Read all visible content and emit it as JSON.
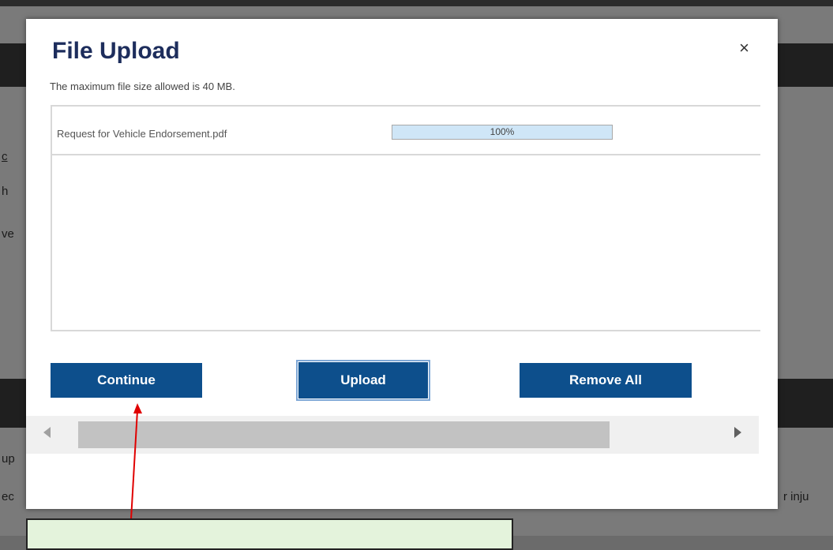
{
  "background": {
    "fragments": [
      "c",
      "h",
      "ve",
      "up",
      "ec",
      "r inju"
    ]
  },
  "modal": {
    "title": "File Upload",
    "close_glyph": "×",
    "max_size_note": "The maximum file size allowed is 40 MB.",
    "files": [
      {
        "name": "Request for Vehicle Endorsement.pdf",
        "progress_label": "100%",
        "progress": 1.0
      }
    ],
    "buttons": {
      "continue": "Continue",
      "upload": "Upload",
      "remove_all": "Remove All"
    },
    "scrollbar": {
      "left_icon": "scroll-left-arrow",
      "right_icon": "scroll-right-arrow"
    }
  },
  "colors": {
    "primary_button": "#0d4f8c",
    "title": "#1d2d5c",
    "progress_fill": "#cfe6f7",
    "annotation_arrow": "#e00000",
    "annotation_box": "#e4f3dc"
  }
}
